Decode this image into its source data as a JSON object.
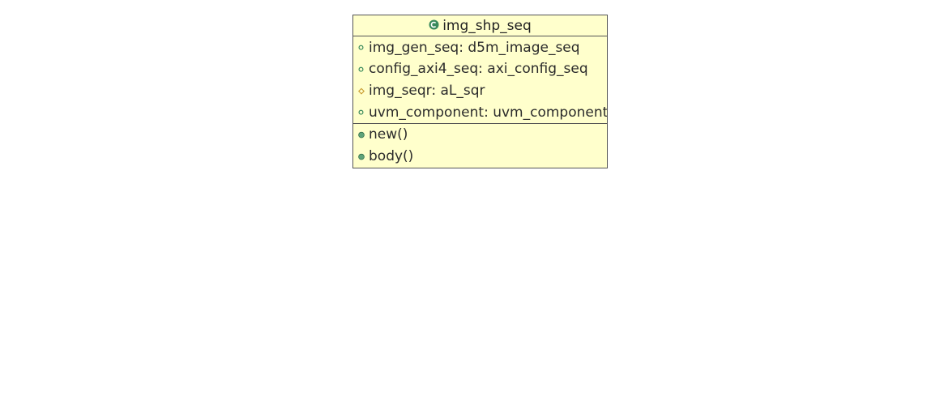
{
  "class": {
    "name": "img_shp_seq",
    "icon": "class-icon",
    "attributes": [
      {
        "text": "img_gen_seq: d5m_image_seq",
        "visibility": "public",
        "icon": "public-field-icon"
      },
      {
        "text": "config_axi4_seq: axi_config_seq",
        "visibility": "public",
        "icon": "public-field-icon"
      },
      {
        "text": "img_seqr: aL_sqr",
        "visibility": "protected",
        "icon": "protected-field-icon"
      },
      {
        "text": "uvm_component: uvm_component_h",
        "visibility": "public",
        "icon": "public-field-icon"
      }
    ],
    "methods": [
      {
        "text": "new()",
        "visibility": "public",
        "icon": "public-method-icon"
      },
      {
        "text": "body()",
        "visibility": "public",
        "icon": "public-method-icon"
      }
    ]
  },
  "colors": {
    "box_fill": "#ffffcc",
    "box_border": "#555555",
    "public_green": "#3a8a5c",
    "protected_orange": "#c89b2e"
  }
}
